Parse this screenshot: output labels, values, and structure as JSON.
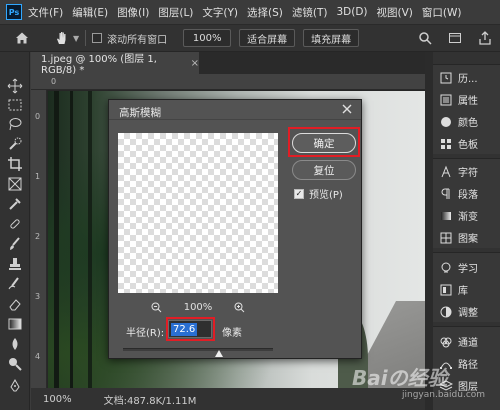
{
  "app": {
    "logo_text": "Ps"
  },
  "menu": [
    "文件(F)",
    "编辑(E)",
    "图像(I)",
    "图层(L)",
    "文字(Y)",
    "选择(S)",
    "滤镜(T)",
    "3D(D)",
    "视图(V)",
    "窗口(W)"
  ],
  "options": {
    "scroll_all_label": "滚动所有窗口",
    "zoom_value": "100%",
    "fit_screen_label": "适合屏幕",
    "fill_screen_label": "填充屏幕"
  },
  "document": {
    "tab_title": "1.jpeg @ 100% (图层 1, RGB/8) *",
    "tab_close": "×",
    "ruler_top_label": "0",
    "ruler_left_labels": [
      "0",
      "1",
      "2",
      "3",
      "4"
    ]
  },
  "status": {
    "zoom": "100%",
    "doc_info": "文档:487.8K/1.11M"
  },
  "panels": [
    {
      "label": "历...",
      "icon": "history-icon"
    },
    {
      "label": "属性",
      "icon": "properties-icon"
    },
    {
      "label": "颜色",
      "icon": "color-icon"
    },
    {
      "label": "色板",
      "icon": "swatches-icon"
    },
    {
      "label": "字符",
      "icon": "character-icon"
    },
    {
      "label": "段落",
      "icon": "paragraph-icon"
    },
    {
      "label": "渐变",
      "icon": "gradient-icon"
    },
    {
      "label": "图案",
      "icon": "patterns-icon"
    },
    {
      "label": "学习",
      "icon": "learn-icon"
    },
    {
      "label": "库",
      "icon": "libraries-icon"
    },
    {
      "label": "调整",
      "icon": "adjustments-icon"
    },
    {
      "label": "通道",
      "icon": "channels-icon"
    },
    {
      "label": "路径",
      "icon": "paths-icon"
    },
    {
      "label": "图层",
      "icon": "layers-icon"
    }
  ],
  "dialog": {
    "title": "高斯模糊",
    "ok_label": "确定",
    "reset_label": "复位",
    "preview_label": "预览(P)",
    "preview_checked": true,
    "zoom_value": "100%",
    "radius_label": "半径(R):",
    "radius_value": "72.6",
    "radius_unit": "像素",
    "slider_level_fraction": 0.64
  },
  "watermark": {
    "brand": "Baiの经验",
    "url": "jingyan.baidu.com"
  },
  "colors": {
    "highlight": "#e21d25",
    "selection": "#2a6fd2"
  }
}
